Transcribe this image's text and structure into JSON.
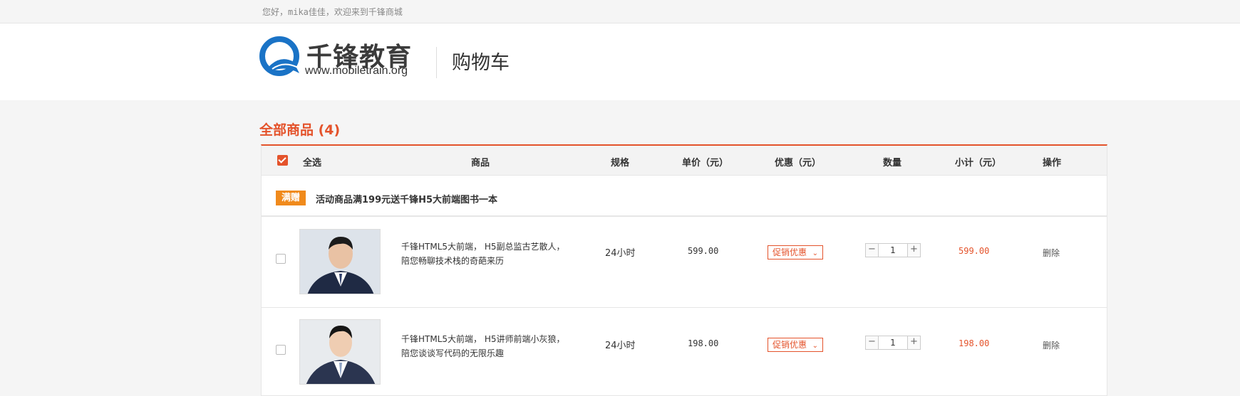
{
  "topbar": {
    "greeting": "您好，mika佳佳，欢迎来到千锋商城"
  },
  "header": {
    "logo_cn": "千锋教育",
    "logo_url": "www.mobiletrain.org",
    "page_title": "购物车"
  },
  "section": {
    "title": "全部商品 (4)"
  },
  "table": {
    "select_all_checked": true,
    "columns": {
      "select_all": "全选",
      "product": "商品",
      "spec": "规格",
      "unit_price": "单价（元）",
      "discount": "优惠（元）",
      "quantity": "数量",
      "subtotal": "小计（元）",
      "action": "操作"
    }
  },
  "promo": {
    "tag": "满赠",
    "text": "活动商品满199元送千锋H5大前端图书一本"
  },
  "items": [
    {
      "checked": false,
      "desc_line1": "千锋HTML5大前端， H5副总监古艺散人，",
      "desc_line2": "陪您畅聊技术栈的奇葩来历",
      "spec": "24小时",
      "price": "599.00",
      "discount_label": "促销优惠",
      "quantity": "1",
      "subtotal": "599.00",
      "action": "删除"
    },
    {
      "checked": false,
      "desc_line1": "千锋HTML5大前端， H5讲师前端小灰狼，",
      "desc_line2": "陪您谈谈写代码的无限乐趣",
      "spec": "24小时",
      "price": "198.00",
      "discount_label": "促销优惠",
      "quantity": "1",
      "subtotal": "198.00",
      "action": "删除"
    }
  ],
  "icons": {
    "qty_minus": "−",
    "qty_plus": "+",
    "chevron": "⌄"
  },
  "colors": {
    "accent": "#e4532b",
    "promo_tag": "#f08a1c",
    "logo_blue": "#1a73c6"
  }
}
